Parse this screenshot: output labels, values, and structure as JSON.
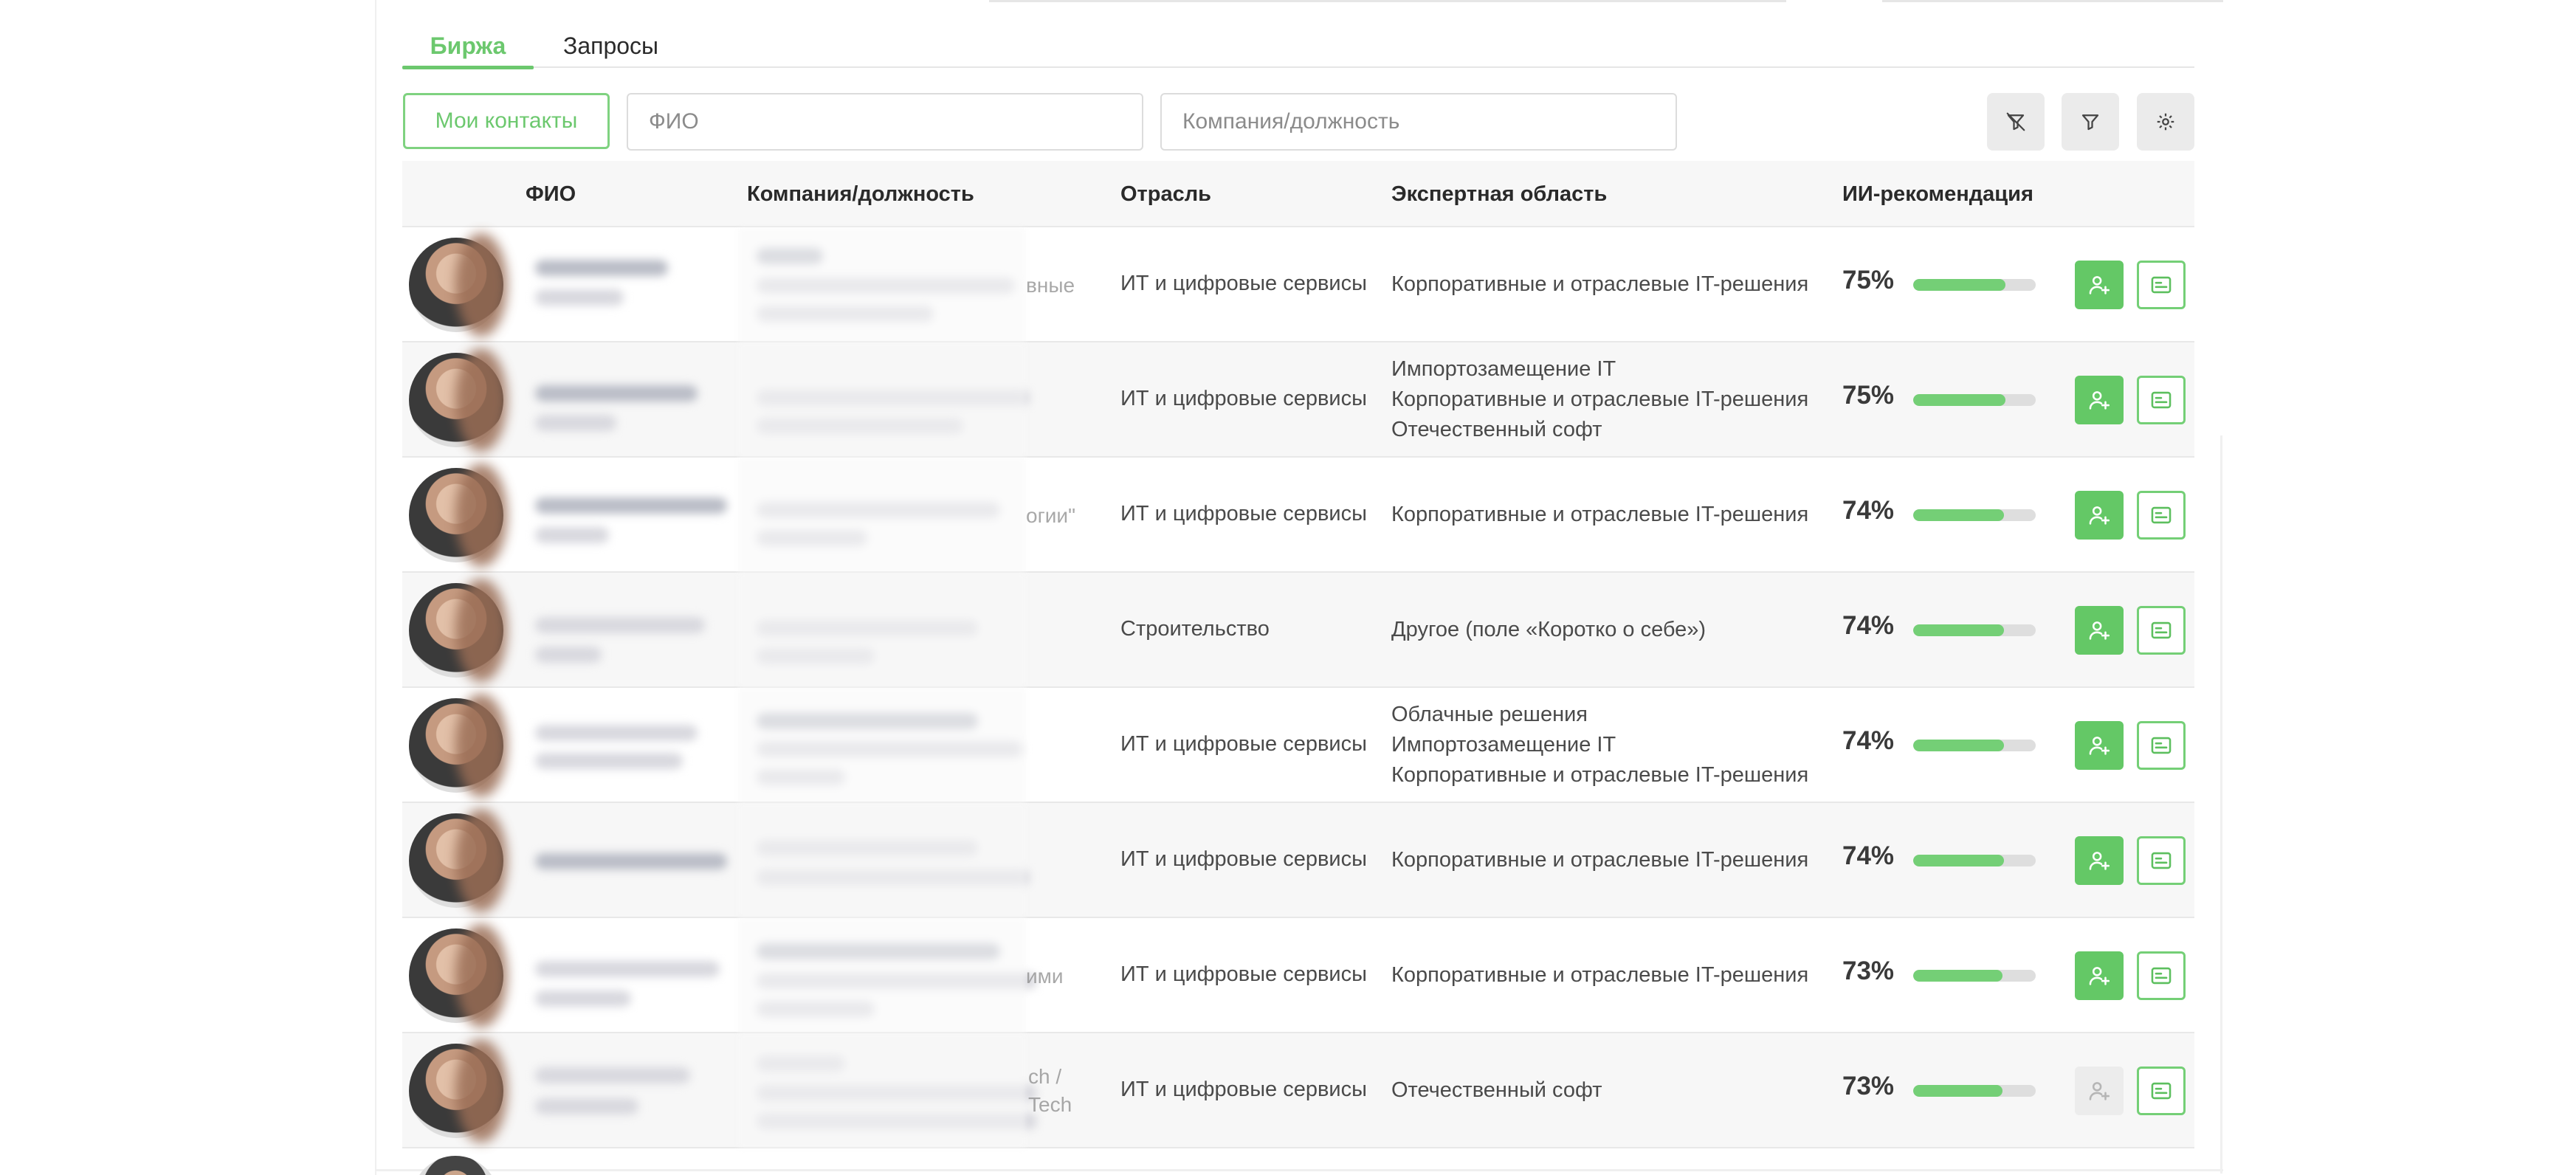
{
  "tabs": [
    {
      "label": "Биржа",
      "active": true
    },
    {
      "label": "Запросы",
      "active": false
    }
  ],
  "toolbar": {
    "my_contacts_label": "Мои контакты",
    "fio_placeholder": "ФИО",
    "company_placeholder": "Компания/должность",
    "icons": [
      "filter-clear-icon",
      "filter-icon",
      "settings-icon"
    ]
  },
  "table": {
    "headers": {
      "fio": "ФИО",
      "company": "Компания/должность",
      "industry": "Отрасль",
      "expert": "Экспертная область",
      "ai": "ИИ-рекомендация"
    },
    "rows": [
      {
        "company_tail": "вные",
        "industry": "ИТ и цифровые сервисы",
        "expert": [
          "Корпоративные и отраслевые IT-решения"
        ],
        "pct": "75%",
        "value": 75,
        "can_add": true
      },
      {
        "company_tail": "",
        "industry": "ИТ и цифровые сервисы",
        "expert": [
          "Импортозамещение IT",
          "Корпоративные и отраслевые IT-решения",
          "Отечественный софт"
        ],
        "pct": "75%",
        "value": 75,
        "can_add": true
      },
      {
        "company_tail": "огии\"",
        "industry": "ИТ и цифровые сервисы",
        "expert": [
          "Корпоративные и отраслевые IT-решения"
        ],
        "pct": "74%",
        "value": 74,
        "can_add": true
      },
      {
        "company_tail": "",
        "industry": "Строительство",
        "expert": [
          "Другое (поле «Коротко о себе»)"
        ],
        "pct": "74%",
        "value": 74,
        "can_add": true
      },
      {
        "company_tail": "",
        "industry": "ИТ и цифровые сервисы",
        "expert": [
          "Облачные решения",
          "Импортозамещение IT",
          "Корпоративные и отраслевые IT-решения"
        ],
        "pct": "74%",
        "value": 74,
        "can_add": true
      },
      {
        "company_tail": "",
        "industry": "ИТ и цифровые сервисы",
        "expert": [
          "Корпоративные и отраслевые IT-решения"
        ],
        "pct": "74%",
        "value": 74,
        "can_add": true
      },
      {
        "company_tail": "ими",
        "industry": "ИТ и цифровые сервисы",
        "expert": [
          "Корпоративные и отраслевые IT-решения"
        ],
        "pct": "73%",
        "value": 73,
        "can_add": true
      },
      {
        "company_tail": "ch /\nTech",
        "industry": "ИТ и цифровые сервисы",
        "expert": [
          "Отечественный софт"
        ],
        "pct": "73%",
        "value": 73,
        "can_add": false
      }
    ]
  },
  "colors": {
    "accent": "#6cc86e",
    "accent_button": "#64c866",
    "progress_track": "#dedede"
  }
}
